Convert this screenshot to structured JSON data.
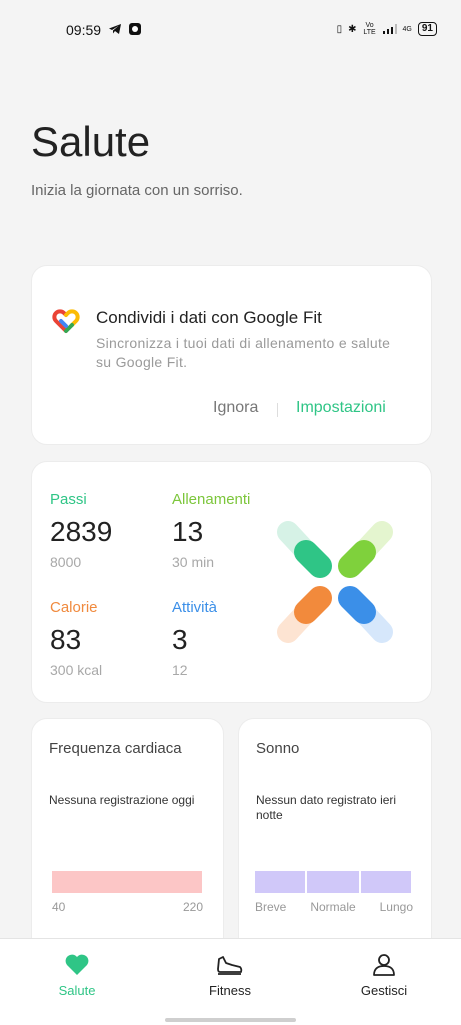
{
  "status": {
    "time": "09:59",
    "battery": "91",
    "network": "4G",
    "volte": "Vo LTE"
  },
  "header": {
    "title": "Salute",
    "subtitle": "Inizia la giornata con un sorriso."
  },
  "google_fit": {
    "title": "Condividi i dati con Google Fit",
    "description": "Sincronizza i tuoi dati di allenamento e salute su Google Fit.",
    "ignore": "Ignora",
    "settings": "Impostazioni"
  },
  "activity": {
    "steps": {
      "label": "Passi",
      "value": "2839",
      "goal": "8000"
    },
    "workout": {
      "label": "Allenamenti",
      "value": "13",
      "goal": "30 min"
    },
    "calories": {
      "label": "Calorie",
      "value": "83",
      "goal": "300 kcal"
    },
    "activity": {
      "label": "Attività",
      "value": "3",
      "goal": "12"
    }
  },
  "heart_rate": {
    "title": "Frequenza cardiaca",
    "note": "Nessuna registrazione oggi",
    "min": "40",
    "max": "220"
  },
  "sleep": {
    "title": "Sonno",
    "note": "Nessun dato registrato ieri notte",
    "labels": [
      "Breve",
      "Normale",
      "Lungo"
    ]
  },
  "nav": [
    {
      "label": "Salute",
      "icon": "heart-icon"
    },
    {
      "label": "Fitness",
      "icon": "shoe-icon"
    },
    {
      "label": "Gestisci",
      "icon": "person-icon"
    }
  ],
  "colors": {
    "accent": "#2fc586",
    "steps": "#2fc586",
    "workout": "#7cc63b",
    "calories": "#f08a3e",
    "activity": "#3b8fe8"
  }
}
